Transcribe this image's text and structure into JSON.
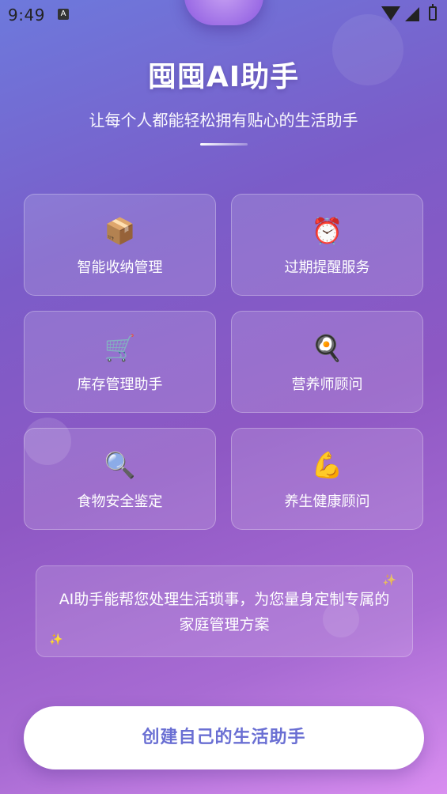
{
  "status_bar": {
    "time": "9:49",
    "notification_icon": "A"
  },
  "header": {
    "title": "囤囤AI助手",
    "subtitle": "让每个人都能轻松拥有贴心的生活助手"
  },
  "features": [
    {
      "icon": "📦",
      "icon_name": "package-icon",
      "label": "智能收纳管理"
    },
    {
      "icon": "⏰",
      "icon_name": "alarm-clock-icon",
      "label": "过期提醒服务"
    },
    {
      "icon": "🛒",
      "icon_name": "shopping-cart-icon",
      "label": "库存管理助手"
    },
    {
      "icon": "🍳",
      "icon_name": "frying-pan-icon",
      "label": "营养师顾问"
    },
    {
      "icon": "🔍",
      "icon_name": "magnifier-icon",
      "label": "食物安全鉴定"
    },
    {
      "icon": "💪",
      "icon_name": "flexed-biceps-icon",
      "label": "养生健康顾问"
    }
  ],
  "info": {
    "text": "AI助手能帮您处理生活琐事，为您量身定制专属的家庭管理方案",
    "sparkle": "✨"
  },
  "cta": {
    "label": "创建自己的生活助手"
  },
  "colors": {
    "accent": "#6a6fd3",
    "gradient_start": "#6d79dc",
    "gradient_end": "#d98ef0"
  }
}
